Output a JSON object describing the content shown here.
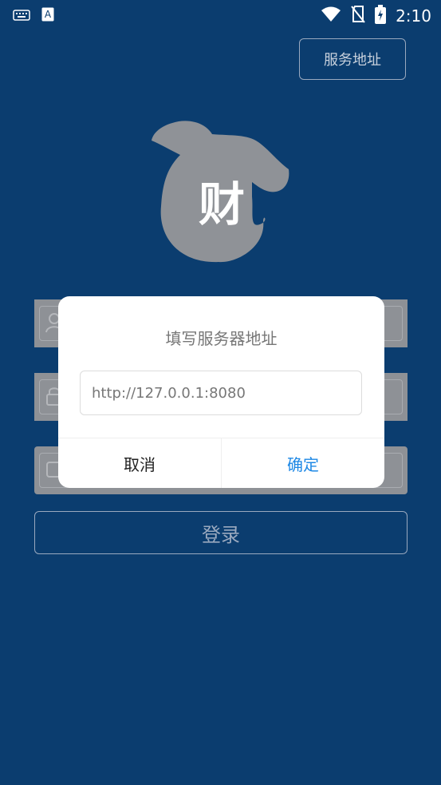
{
  "status_bar": {
    "time": "2:10",
    "icons": [
      "keyboard-icon",
      "text-a-icon",
      "wifi-icon",
      "no-sim-icon",
      "battery-charging-icon"
    ]
  },
  "header": {
    "server_button_label": "服务地址"
  },
  "logo": {
    "character": "财",
    "color": "#8f9297"
  },
  "login": {
    "login_button_label": "登录"
  },
  "dialog": {
    "title": "填写服务器地址",
    "input_value": "http://127.0.0.1:8080",
    "cancel_label": "取消",
    "confirm_label": "确定"
  },
  "colors": {
    "background": "#0b3d6f",
    "confirm": "#1e88e5"
  }
}
